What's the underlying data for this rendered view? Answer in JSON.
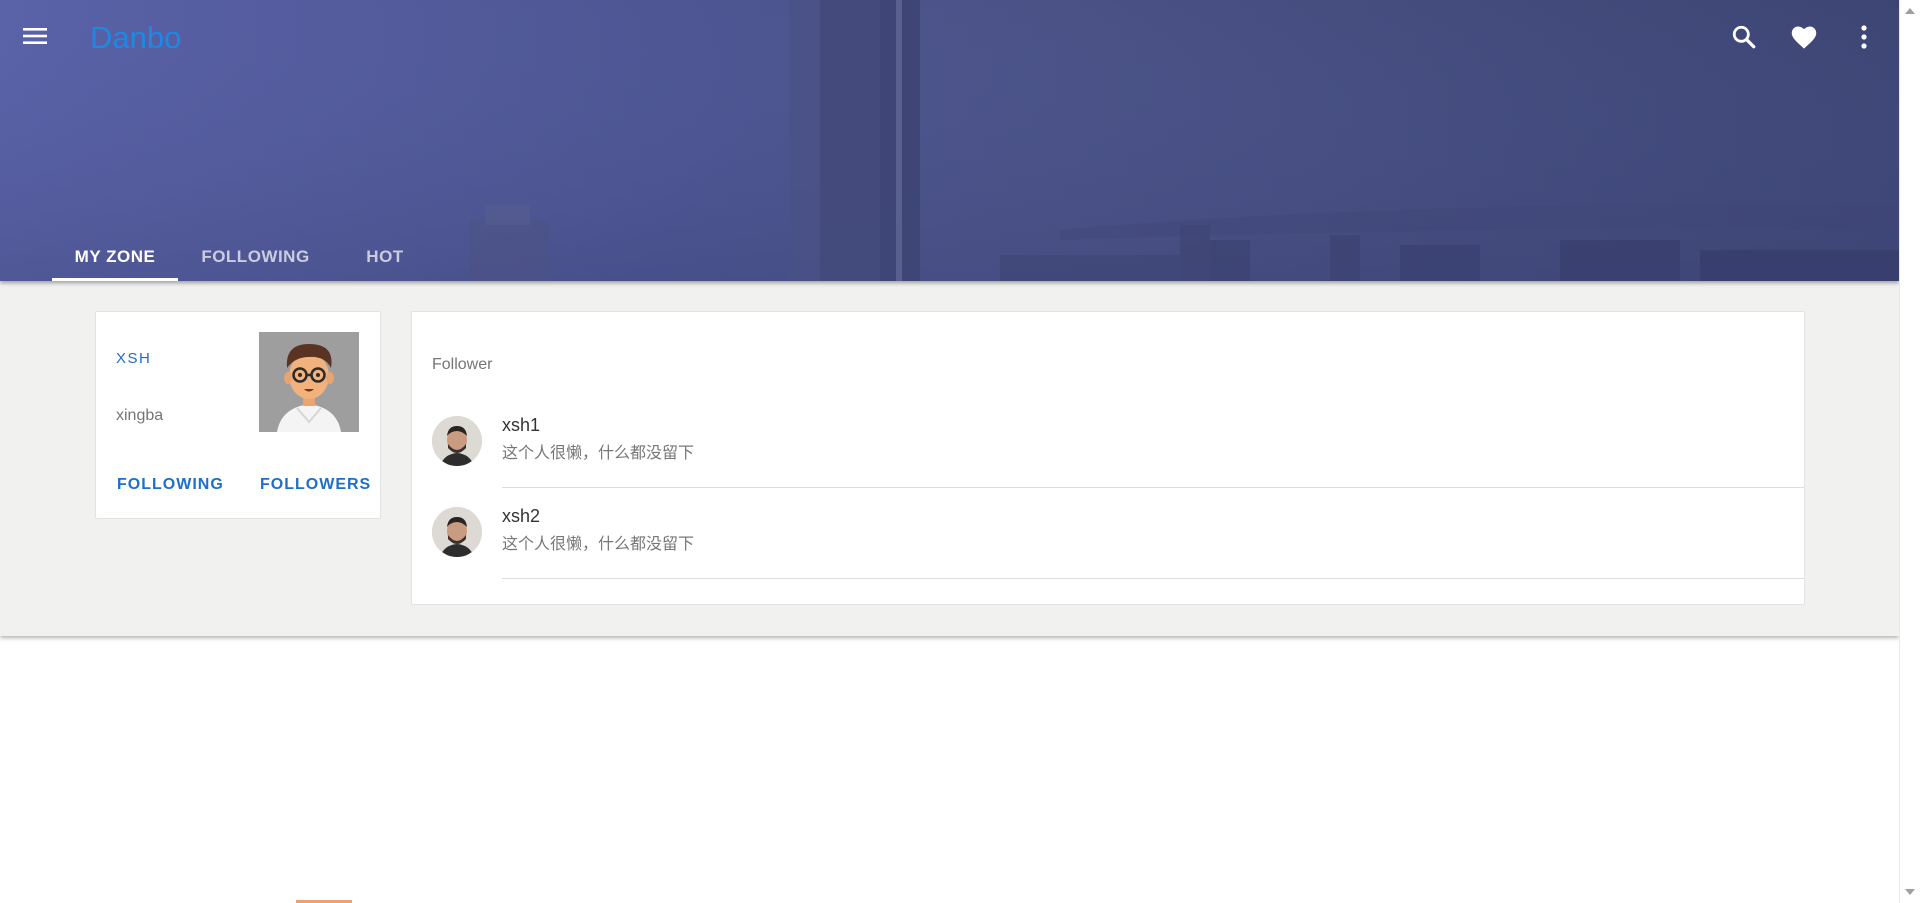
{
  "header": {
    "brand": "Danbo",
    "icons": [
      "menu-icon",
      "search-icon",
      "heart-icon",
      "more-vert-icon"
    ],
    "tabs": [
      {
        "label": "MY ZONE",
        "active": true
      },
      {
        "label": "FOLLOWING",
        "active": false
      },
      {
        "label": "HOT",
        "active": false
      }
    ]
  },
  "profile": {
    "name": "XSH",
    "username": "xingba",
    "following_label": "FOLLOWING",
    "followers_label": "FOLLOWERS"
  },
  "followers": {
    "title": "Follower",
    "items": [
      {
        "name": "xsh1",
        "bio": "这个人很懒，什么都没留下"
      },
      {
        "name": "xsh2",
        "bio": "这个人很懒，什么都没留下"
      }
    ]
  },
  "colors": {
    "accent": "#1e88e5",
    "link": "#1e6fc8",
    "header_bg": "#4e5694",
    "page_bg": "#f1f1f0"
  }
}
